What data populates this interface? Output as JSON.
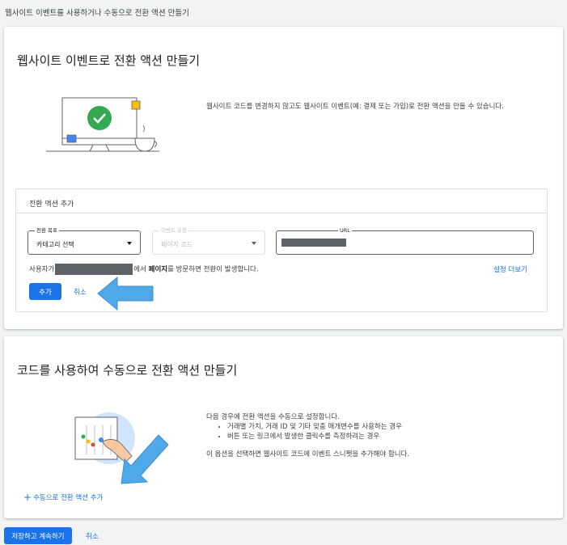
{
  "caption": "웹사이트 이벤트를 사용하거나 수동으로 전환 액션 만들기",
  "website_section": {
    "title": "웹사이트 이벤트로 전환 액션 만들기",
    "description": "웹사이트 코드를 변경하지 않고도 웹사이트 이벤트(예: 결제 또는 가입)로 전환 액션을 만들 수 있습니다.",
    "panel": {
      "title": "전환 액션 추가",
      "goal_field": {
        "label": "전환 목표",
        "value": "카테고리 선택"
      },
      "event_type_field": {
        "label": "이벤트 유형",
        "value": "페이지 로드"
      },
      "url_field": {
        "label": "URL"
      },
      "info_prefix": "사용자가",
      "info_mid": "에서",
      "info_bold": "페이지",
      "info_suffix": "를 방문하면 전환이 발생합니다.",
      "more_settings": "설정 더보기",
      "add_button": "추가",
      "cancel": "취소"
    }
  },
  "manual_section": {
    "title": "코드를 사용하여 수동으로 전환 액션 만들기",
    "intro": "다음 경우에 전환 액션을 수동으로 설정합니다.",
    "bullets": [
      "거래별 가치, 거래 ID 및 기타 맞춤 매개변수를 사용하는 경우",
      "버튼 또는 링크에서 발생한 클릭수를 측정하려는 경우"
    ],
    "note": "이 옵션을 선택하면 웹사이트 코드에 이벤트 스니펫을 추가해야 합니다.",
    "add_manual": "수동으로 전환 액션 추가"
  },
  "footer": {
    "save_continue": "저장하고 계속하기",
    "cancel": "취소"
  },
  "colors": {
    "primary": "#1a73e8",
    "green": "#34a853",
    "yellow": "#fbbc04",
    "red": "#ea4335",
    "arrow": "#4fa8e8"
  }
}
